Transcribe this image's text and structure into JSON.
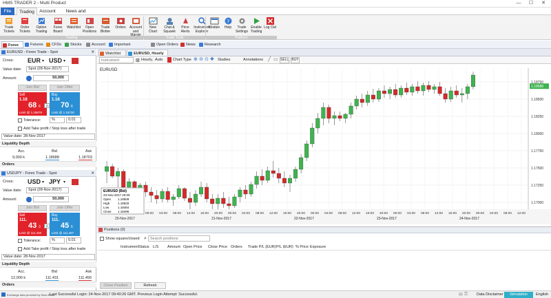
{
  "app": {
    "title": "HMS TRADER 2 - Multi Product"
  },
  "menu": [
    "File",
    "Trading",
    "Account",
    "News and Research"
  ],
  "ribbon": {
    "buttons": [
      {
        "label": "Trade Tickets",
        "icon": "trade-tickets-icon"
      },
      {
        "label": "Order Tickets",
        "icon": "order-tickets-icon"
      },
      {
        "label": "Option Trading",
        "icon": "option-trading-icon"
      },
      {
        "label": "Forex Board",
        "icon": "forex-board-icon"
      },
      {
        "label": "Watchlist",
        "icon": "watchlist-icon"
      },
      {
        "label": "Open Positions",
        "icon": "open-positions-icon"
      },
      {
        "label": "Trade Blotter",
        "icon": "trade-blotter-icon"
      },
      {
        "label": "Orders",
        "icon": "orders-icon"
      },
      {
        "label": "Account and Margin",
        "icon": "account-margin-icon"
      },
      {
        "label": "New Chart",
        "icon": "new-chart-icon"
      },
      {
        "label": "Chat & Squawk",
        "icon": "chat-icon"
      },
      {
        "label": "Price Alerts",
        "icon": "price-alerts-icon"
      },
      {
        "label": "Instrument Explorer",
        "icon": "instrument-explorer-icon"
      },
      {
        "label": "Module",
        "icon": "module-icon"
      },
      {
        "label": "Help",
        "icon": "help-icon"
      },
      {
        "label": "Trade Settings",
        "icon": "trade-settings-icon"
      },
      {
        "label": "Enable Trading",
        "icon": "enable-trading-icon"
      },
      {
        "label": "Log Out",
        "icon": "log-out-icon"
      }
    ],
    "groups": [
      "Trading",
      "Trade Tools",
      "Platform"
    ]
  },
  "workspace_tabs": [
    {
      "label": "Forex",
      "color": "#d03030"
    },
    {
      "label": "Futures",
      "color": "#3a7bd5"
    },
    {
      "label": "CFDs",
      "color": "#e08a1e"
    },
    {
      "label": "Stocks",
      "color": "#3aa04a"
    },
    {
      "label": "Account",
      "color": "#888888"
    },
    {
      "label": "Important Information",
      "color": "#3a7bd5"
    },
    {
      "label": "Open Orders",
      "color": "#888888"
    },
    {
      "label": "News",
      "color": "#d03030"
    },
    {
      "label": "Research",
      "color": "#3a7bd5"
    }
  ],
  "ticket1": {
    "title": "EURUSD - Forex Trade - Spot",
    "cross_label": "Cross:",
    "base": "EUR",
    "quote": "USD",
    "value_date_label": "Value date:",
    "value_date": "Spot (28-Nov-2017)",
    "amount_label": "Amount:",
    "amount": "50,000",
    "join_bid": "Join Bid",
    "join_offer": "Join Offer",
    "sell_label": "Sell",
    "sell_big": "1.18",
    "sell_pips": "68",
    "sell_frac": "6",
    "sell_limit": "Limit @ 1.18679",
    "spread": "2.0",
    "buy_label": "Buy",
    "buy_big": "1.18",
    "buy_pips": "70",
    "buy_frac": "6",
    "buy_limit": "Limit @ 1.18720",
    "tolerance_label": "Tolerance:",
    "tolerance_unit": "%",
    "tolerance": "0.01",
    "tp_label": "Add Take profit / Stop loss after trade",
    "value_date_box": "Value date: 28-Nov-2017",
    "depth_title": "Liquidity Depth",
    "depth_headers": [
      "Acc.",
      "Bid",
      "Ask"
    ],
    "depth_row": [
      "9,000 k",
      "1.18688",
      "1.18703"
    ],
    "orders_title": "Orders"
  },
  "ticket2": {
    "title": "USDJPY - Forex Trade - Spot",
    "cross_label": "Cross:",
    "base": "USD",
    "quote": "JPY",
    "value_date_label": "Value date:",
    "value_date": "Spot (28-Nov-2017)",
    "amount_label": "Amount:",
    "amount": "50,000",
    "join_bid": "Join Bid",
    "join_offer": "Join Offer",
    "sell_label": "Sell",
    "sell_big": "111.",
    "sell_pips": "43",
    "sell_frac": "3",
    "sell_limit": "Limit @ 111.420",
    "spread": "2.3",
    "buy_label": "Buy",
    "buy_big": "111.",
    "buy_pips": "45",
    "buy_frac": "6",
    "buy_limit": "Limit @ 111.467",
    "tolerance_label": "Tolerance:",
    "tolerance_unit": "%",
    "tolerance": "0.01",
    "tp_label": "Add Take profit / Stop loss after trade",
    "value_date_box": "Value date: 28-Nov-2017",
    "depth_title": "Liquidity Depth",
    "depth_headers": [
      "Acc.",
      "Bid",
      "Ask"
    ],
    "depth_row": [
      "12,000 k",
      "111.431",
      "111.456"
    ],
    "orders_title": "Orders"
  },
  "chart_tabs": [
    "Watchlist",
    "EURUSD, Hourly"
  ],
  "chart_toolbar": {
    "instrument_placeholder": "Instrument",
    "interval": "Hourly,",
    "mode": "Auto",
    "chart_type": "Chart Type",
    "studies": "Studies",
    "annotations": "Annotations",
    "sell": "SELL",
    "buy": "BUY"
  },
  "chart_data": {
    "type": "candlestick",
    "symbol_label": "EURUSD",
    "ohlc_box": {
      "title": "EURUSD (Bid)",
      "rows": [
        [
          "",
          "23-Nov-2017 20:00"
        ],
        [
          "Open",
          "1.18509"
        ],
        [
          "High",
          "1.18526"
        ],
        [
          "Low",
          "1.18484"
        ],
        [
          "Close",
          "1.18496"
        ]
      ]
    },
    "y_ticks": [
      "1.18750",
      "1.18500",
      "1.18250",
      "1.18000",
      "1.17750",
      "1.17500",
      "1.17250",
      "1.17000"
    ],
    "y_range": [
      1.169,
      1.1895
    ],
    "current_price": "1.18688",
    "x_ticks": [
      "12:00",
      "16:00",
      "20:00",
      "00:00",
      "04:00",
      "08:00",
      "12:00",
      "16:00",
      "20:00",
      "00:00",
      "04:00",
      "08:00",
      "12:00",
      "16:00",
      "20:00",
      "00:00",
      "04:00",
      "08:00",
      "12:00",
      "16:00",
      "20:00",
      "00:00",
      "04:00",
      "08:00",
      "12:00",
      "16:00",
      "20:00",
      "00:00",
      "04:00",
      "08:00",
      "12:00"
    ],
    "x_dates": [
      "20-Nov-2017",
      "21-Nov-2017",
      "22-Nov-2017",
      "23-Nov-2017",
      "24-Nov-2017"
    ],
    "colors": {
      "up": "#3fb34f",
      "down": "#d42a2a"
    },
    "candles": [
      [
        1.1745,
        1.176,
        1.1728,
        1.1752
      ],
      [
        1.1752,
        1.1756,
        1.1735,
        1.1738
      ],
      [
        1.1738,
        1.175,
        1.1722,
        1.1745
      ],
      [
        1.1745,
        1.1748,
        1.1715,
        1.1722
      ],
      [
        1.1722,
        1.1735,
        1.171,
        1.173
      ],
      [
        1.173,
        1.1732,
        1.1708,
        1.1712
      ],
      [
        1.1712,
        1.1728,
        1.1705,
        1.1725
      ],
      [
        1.1725,
        1.173,
        1.1708,
        1.1715
      ],
      [
        1.1715,
        1.1722,
        1.17,
        1.171
      ],
      [
        1.171,
        1.1718,
        1.1698,
        1.1705
      ],
      [
        1.1705,
        1.172,
        1.17,
        1.1716
      ],
      [
        1.1716,
        1.1722,
        1.17,
        1.1704
      ],
      [
        1.1704,
        1.1712,
        1.1695,
        1.1708
      ],
      [
        1.1708,
        1.1725,
        1.1705,
        1.172
      ],
      [
        1.172,
        1.1722,
        1.1702,
        1.1706
      ],
      [
        1.1706,
        1.1715,
        1.169,
        1.17
      ],
      [
        1.17,
        1.1718,
        1.1695,
        1.1712
      ],
      [
        1.1712,
        1.173,
        1.1708,
        1.1722
      ],
      [
        1.1722,
        1.1728,
        1.17,
        1.1705
      ],
      [
        1.1705,
        1.1712,
        1.169,
        1.1698
      ],
      [
        1.1698,
        1.1712,
        1.1688,
        1.1706
      ],
      [
        1.1706,
        1.1715,
        1.1692,
        1.1698
      ],
      [
        1.1698,
        1.1708,
        1.1688,
        1.1695
      ],
      [
        1.1695,
        1.1712,
        1.1692,
        1.1708
      ],
      [
        1.1708,
        1.1722,
        1.17,
        1.1718
      ],
      [
        1.1718,
        1.1725,
        1.1705,
        1.1712
      ],
      [
        1.1712,
        1.173,
        1.1708,
        1.1726
      ],
      [
        1.1726,
        1.1745,
        1.172,
        1.1738
      ],
      [
        1.1738,
        1.1748,
        1.1725,
        1.1732
      ],
      [
        1.1732,
        1.1752,
        1.1728,
        1.1746
      ],
      [
        1.1746,
        1.176,
        1.1736,
        1.1742
      ],
      [
        1.1742,
        1.175,
        1.1728,
        1.1735
      ],
      [
        1.1735,
        1.1745,
        1.1722,
        1.1728
      ],
      [
        1.1728,
        1.174,
        1.1715,
        1.1735
      ],
      [
        1.1735,
        1.1752,
        1.173,
        1.1748
      ],
      [
        1.1748,
        1.177,
        1.1742,
        1.1765
      ],
      [
        1.1765,
        1.179,
        1.176,
        1.1785
      ],
      [
        1.1785,
        1.1815,
        1.178,
        1.1808
      ],
      [
        1.1808,
        1.183,
        1.18,
        1.1822
      ],
      [
        1.1822,
        1.1845,
        1.1812,
        1.1838
      ],
      [
        1.1838,
        1.1842,
        1.1815,
        1.1822
      ],
      [
        1.1822,
        1.1832,
        1.1812,
        1.1826
      ],
      [
        1.1826,
        1.1832,
        1.1818,
        1.1822
      ],
      [
        1.1822,
        1.183,
        1.1815,
        1.1828
      ],
      [
        1.1828,
        1.1845,
        1.1822,
        1.184
      ],
      [
        1.184,
        1.1855,
        1.1835,
        1.185
      ],
      [
        1.185,
        1.1858,
        1.1838,
        1.1845
      ],
      [
        1.1845,
        1.1862,
        1.184,
        1.1856
      ],
      [
        1.1856,
        1.1865,
        1.1845,
        1.185
      ],
      [
        1.185,
        1.1866,
        1.1846,
        1.1862
      ],
      [
        1.1862,
        1.187,
        1.1852,
        1.1858
      ],
      [
        1.1858,
        1.1868,
        1.185,
        1.1864
      ],
      [
        1.1864,
        1.1872,
        1.1852,
        1.1856
      ],
      [
        1.1856,
        1.187,
        1.1852,
        1.1866
      ],
      [
        1.1866,
        1.1874,
        1.1856,
        1.186
      ],
      [
        1.186,
        1.1872,
        1.1855,
        1.1868
      ],
      [
        1.1868,
        1.1876,
        1.1858,
        1.1862
      ],
      [
        1.1862,
        1.1874,
        1.1855,
        1.187
      ],
      [
        1.187,
        1.1876,
        1.186,
        1.1864
      ],
      [
        1.1864,
        1.1872,
        1.1858,
        1.1868
      ],
      [
        1.1868,
        1.1875,
        1.1855,
        1.1858
      ],
      [
        1.1858,
        1.1866,
        1.1845,
        1.185
      ],
      [
        1.185,
        1.1868,
        1.1846,
        1.1862
      ],
      [
        1.1862,
        1.187,
        1.1852,
        1.1856
      ],
      [
        1.1856,
        1.1866,
        1.1845,
        1.1858
      ],
      [
        1.1858,
        1.1872,
        1.185,
        1.1868
      ],
      [
        1.1868,
        1.189,
        1.1864,
        1.1885
      ]
    ]
  },
  "positions": {
    "title": "Positions (0)",
    "show_closed": "Show square/closed",
    "search_placeholder": "Search positions",
    "columns": [
      "Instrument",
      "Status",
      "L/S",
      "Amount",
      "Open Price",
      "Close Price",
      "Orders",
      "Trade P/L (EUR)",
      "P/L (EUR)",
      "% Price",
      "Exposure"
    ],
    "close_btn": "Close Position",
    "refresh_btn": "Refresh"
  },
  "status": {
    "provider": "Exchange data provided by Saxo Bank",
    "login": "Last Successful Login: 24-Nov-2017 09:40:26 GMT. Previous Login Attempt: Successful.",
    "disclaimer": "Data Disclaimer",
    "mode": "Simulation",
    "language": "English"
  }
}
